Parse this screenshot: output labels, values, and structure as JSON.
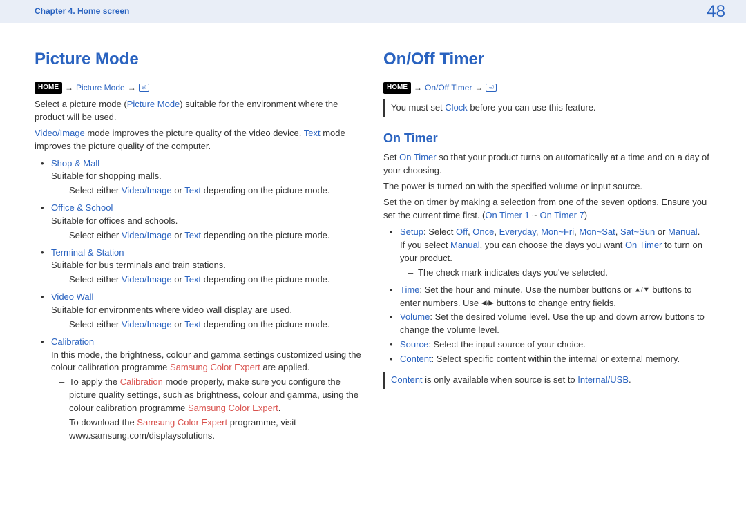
{
  "header": {
    "chapter": "Chapter 4. Home screen",
    "page": "48"
  },
  "left": {
    "title": "Picture Mode",
    "nav_text": "Picture Mode",
    "intro_a": "Select a picture mode (",
    "intro_b": ") suitable for the environment where the product will be used.",
    "desc_a": " mode improves the picture quality of the video device. ",
    "desc_b": " mode improves the picture quality of the computer.",
    "video_image": "Video/Image",
    "text_mode": "Text",
    "picture_mode": "Picture Mode",
    "items": {
      "shop": {
        "title": "Shop & Mall",
        "desc": "Suitable for shopping malls.",
        "sub_a": "Select either ",
        "sub_b": " or ",
        "sub_c": " depending on the picture mode."
      },
      "office": {
        "title": "Office & School",
        "desc": "Suitable for offices and schools.",
        "sub_a": "Select either ",
        "sub_b": " or ",
        "sub_c": " depending on the picture mode."
      },
      "terminal": {
        "title": "Terminal & Station",
        "desc": "Suitable for bus terminals and train stations.",
        "sub_a": "Select either ",
        "sub_b": " or ",
        "sub_c": " depending on the picture mode."
      },
      "videowall": {
        "title": "Video Wall",
        "desc": "Suitable for environments where video wall display are used.",
        "sub_a": "Select either ",
        "sub_b": " or ",
        "sub_c": " depending on the picture mode."
      },
      "calibration": {
        "title": "Calibration",
        "desc_a": "In this mode, the brightness, colour and gamma settings customized using the colour calibration programme ",
        "desc_b": " are applied.",
        "sce": "Samsung Color Expert",
        "sub1_a": "To apply the ",
        "sub1_mode": "Calibration",
        "sub1_b": " mode properly, make sure you configure the picture quality settings, such as brightness, colour and gamma, using the colour calibration programme ",
        "sub1_c": ".",
        "sub2_a": "To download the ",
        "sub2_b": " programme, visit www.samsung.com/displaysolutions."
      }
    }
  },
  "right": {
    "title": "On/Off Timer",
    "nav_text": "On/Off Timer",
    "note1_a": "You must set ",
    "note1_clock": "Clock",
    "note1_b": " before you can use this feature.",
    "on_timer_title": "On Timer",
    "p1_a": "Set ",
    "p1_ot": "On Timer",
    "p1_b": " so that your product turns on automatically at a time and on a day of your choosing.",
    "p2": "The power is turned on with the specified volume or input source.",
    "p3_a": "Set the on timer by making a selection from one of the seven options. Ensure you set the current time first. (",
    "p3_t1": "On Timer 1",
    "p3_tilde": " ~ ",
    "p3_t7": "On Timer 7",
    "p3_b": ")",
    "setup": {
      "label": "Setup",
      "before": ": Select ",
      "off": "Off",
      "once": "Once",
      "everyday": "Everyday",
      "monfri": "Mon~Fri",
      "monsat": "Mon~Sat",
      "satsun": "Sat~Sun",
      "manual": "Manual",
      "after": ".",
      "manual_a": "If you select ",
      "manual_b": ", you can choose the days you want ",
      "manual_c": " to turn on your product.",
      "check": "The check mark indicates days you've selected."
    },
    "time": {
      "label": "Time",
      "a": ": Set the hour and minute. Use the number buttons or ",
      "b": " buttons to enter numbers. Use ",
      "c": " buttons to change entry fields."
    },
    "volume": {
      "label": "Volume",
      "text": ": Set the desired volume level. Use the up and down arrow buttons to change the volume level."
    },
    "source": {
      "label": "Source",
      "text": ": Select the input source of your choice."
    },
    "content": {
      "label": "Content",
      "text": ": Select specific content within the internal or external memory."
    },
    "note2_a": " is only available when source is set to ",
    "note2_b": "Internal/USB",
    "note2_c": "."
  },
  "labels": {
    "home": "HOME",
    "arrow": "→",
    "sep": ", ",
    "or": " or ",
    "slash": "/",
    "enter": "⏎",
    "upDown": "▲/▼",
    "leftRight": "◀/▶"
  }
}
